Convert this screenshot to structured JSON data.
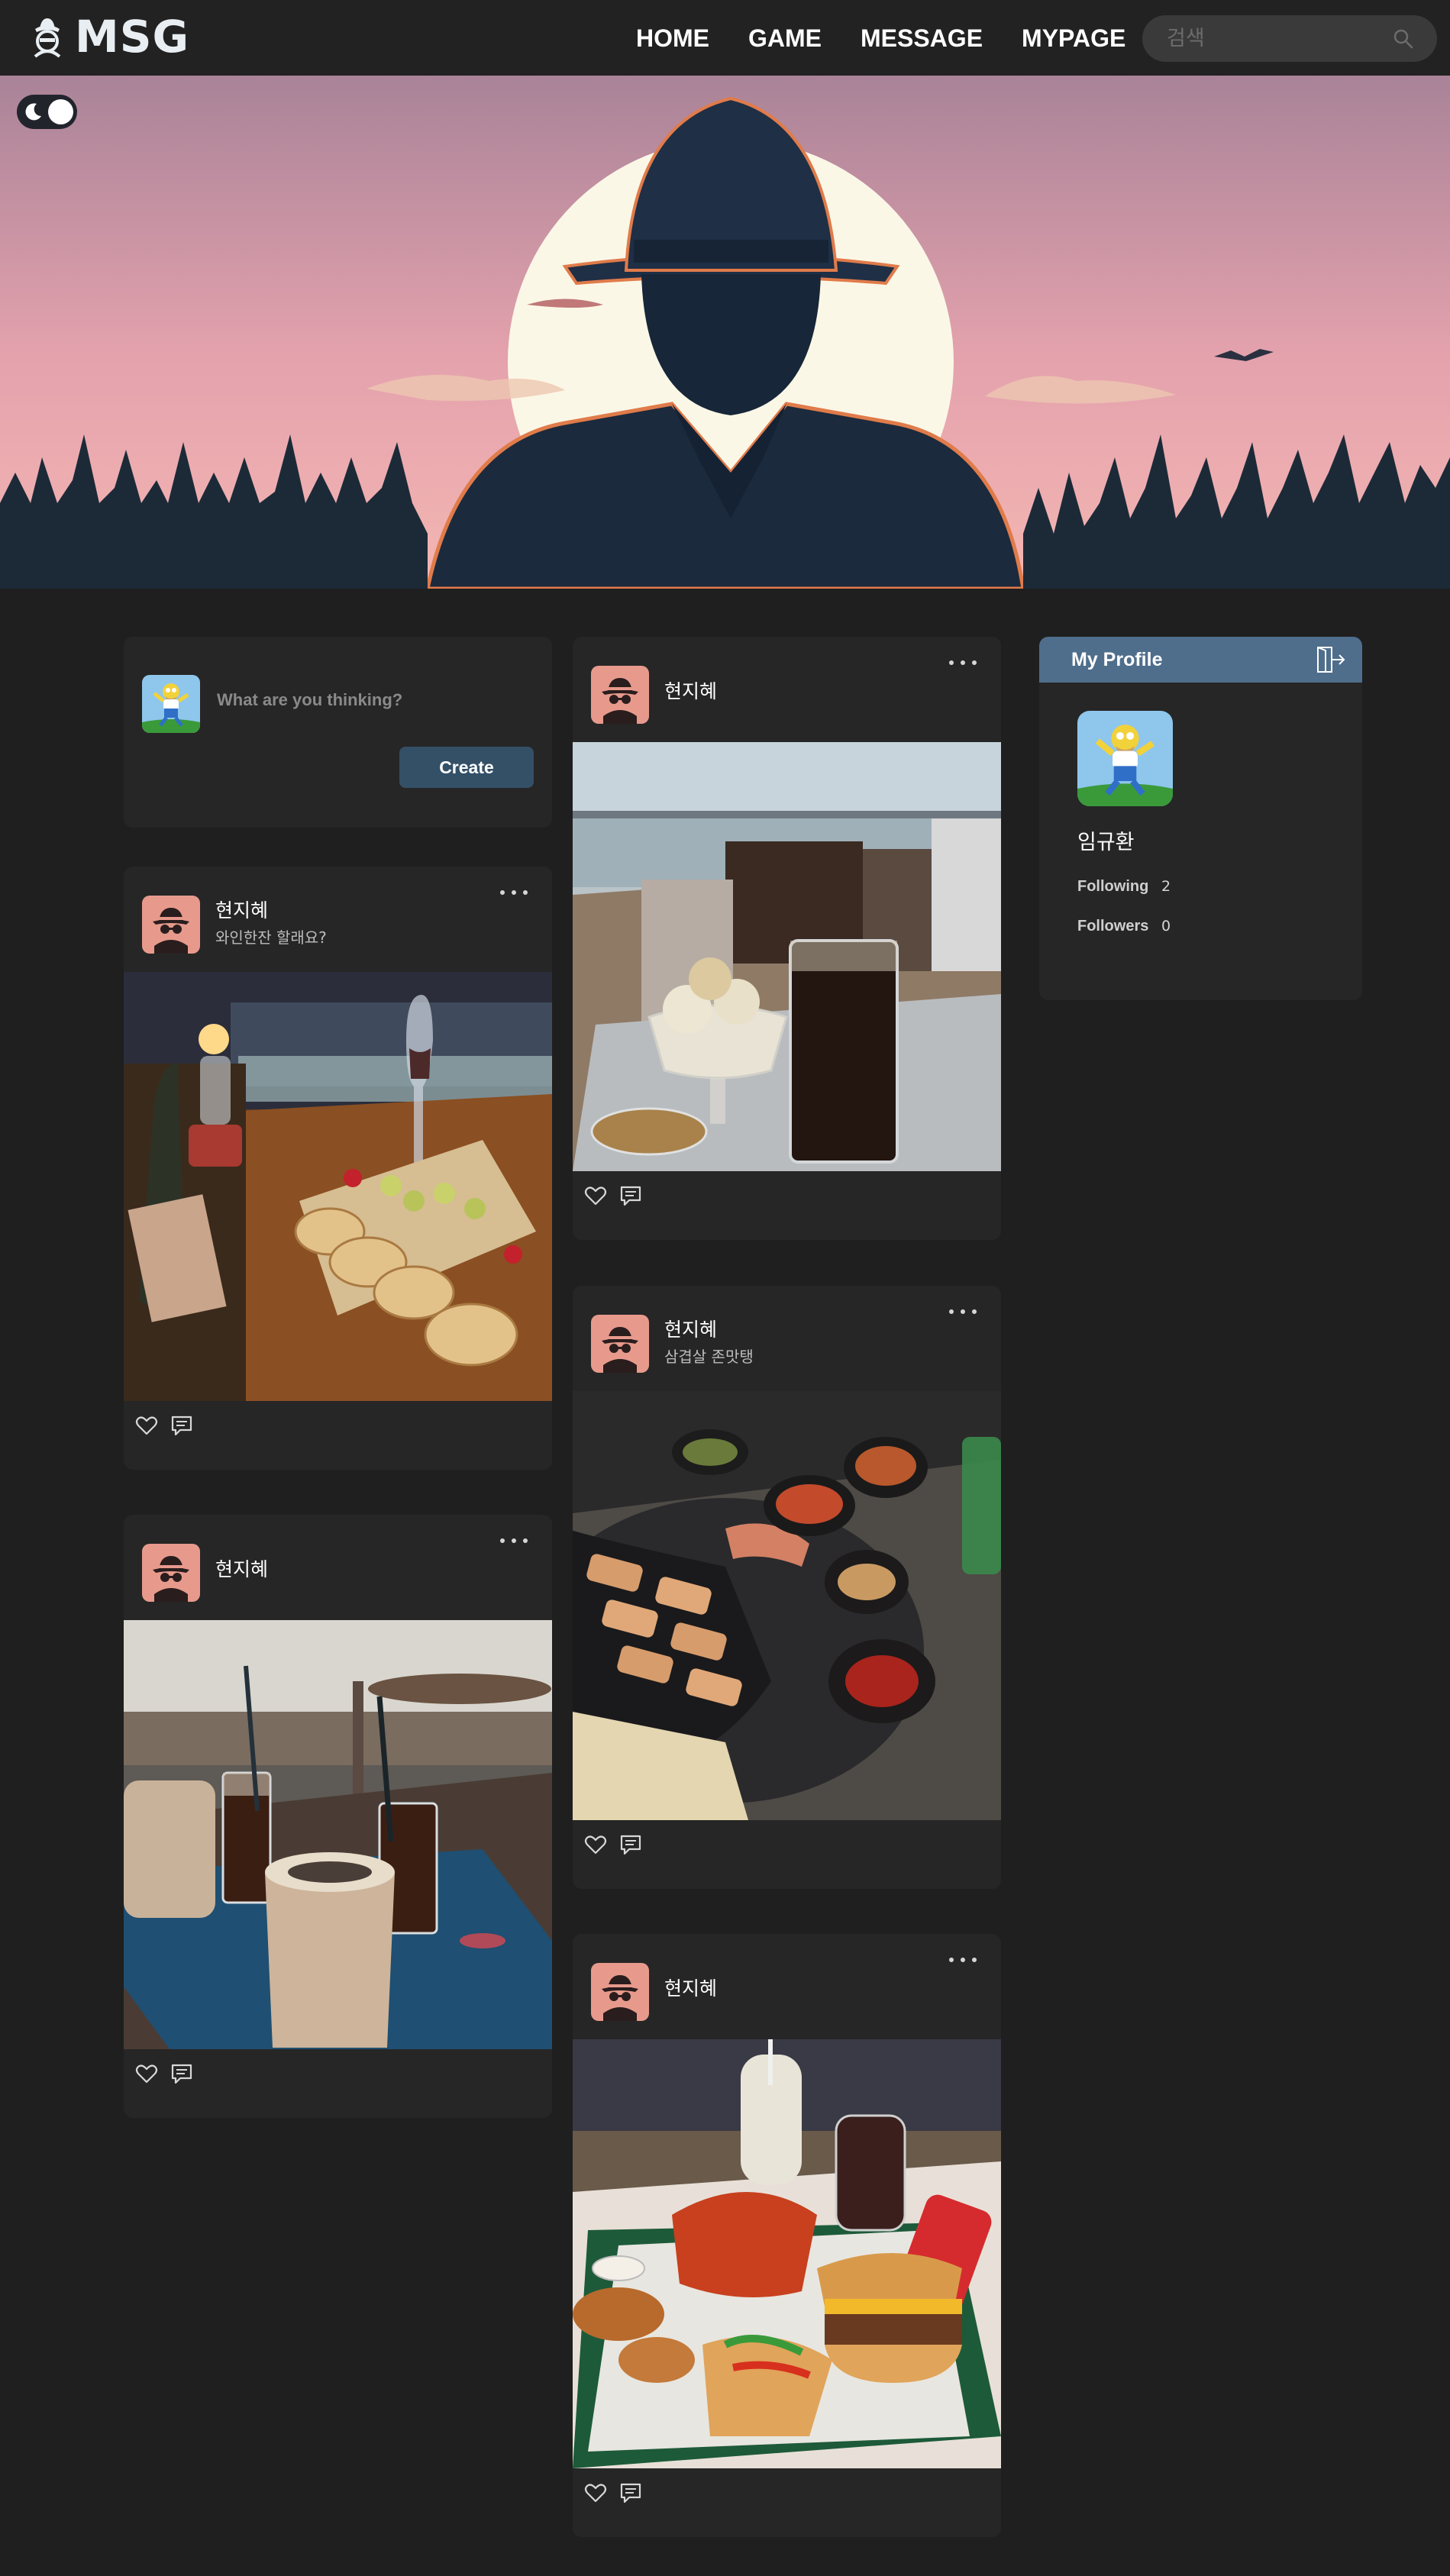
{
  "header": {
    "logo_text": "MSG",
    "nav": [
      "HOME",
      "GAME",
      "MESSAGE",
      "MYPAGE"
    ],
    "search_placeholder": "검색"
  },
  "compose": {
    "placeholder": "What are you thinking?",
    "create_label": "Create"
  },
  "posts": [
    {
      "author": "현지혜",
      "text": "와인한잔 할래요?",
      "photo": "wine-and-bread"
    },
    {
      "author": "현지혜",
      "text": "",
      "photo": "iced-coffee-cafe"
    },
    {
      "author": "현지혜",
      "text": "",
      "photo": "dessert-and-iced-coffee-by-sea"
    },
    {
      "author": "현지혜",
      "text": "삼겹살 존맛탱",
      "photo": "korean-bbq"
    },
    {
      "author": "현지혜",
      "text": "",
      "photo": "burgers-and-cola"
    }
  ],
  "profile": {
    "title": "My Profile",
    "name": "임규환",
    "following_label": "Following",
    "following_count": "2",
    "followers_label": "Followers",
    "followers_count": "0"
  },
  "colors": {
    "page_bg": "#1f1f1f",
    "card_bg": "#262626",
    "header_bg": "#222222",
    "profile_header": "#4f6e8c",
    "create_button": "#345067"
  }
}
